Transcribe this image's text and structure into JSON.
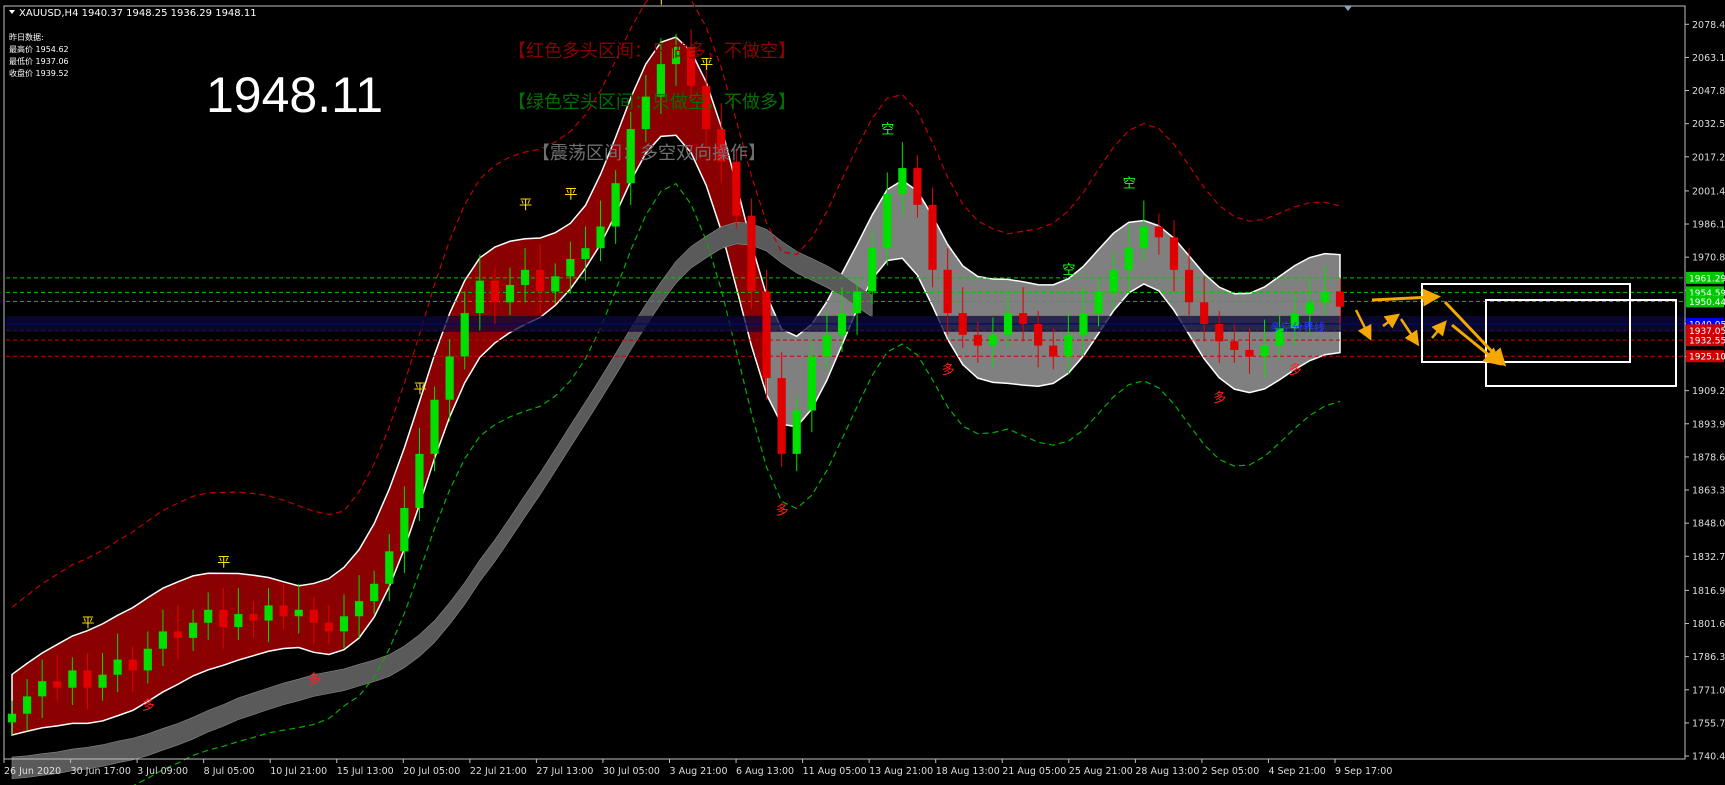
{
  "window": {
    "title": "XAUUSD,H4  1940.37 1948.25 1936.29 1948.11"
  },
  "info_box": {
    "heading": "昨日数据:",
    "lines": [
      "最高价 1954.62",
      "最低价 1937.06",
      "收盘价 1939.52"
    ]
  },
  "big_price": "1948.11",
  "legend_notes": [
    {
      "text": "【红色多头区间：只做多，不做空】",
      "color": "#8b0000"
    },
    {
      "text": "【绿色空头区间：只做空，不做多】",
      "color": "#007000"
    },
    {
      "text": "【震荡区间：多空双向操作】",
      "color": "#707070"
    }
  ],
  "divider_label": "多空分界线",
  "price_tags": [
    {
      "value": "1961.29",
      "color": "#00c800"
    },
    {
      "value": "1954.59",
      "color": "#00c800"
    },
    {
      "value": "1950.44",
      "color": "#00c800"
    },
    {
      "value": "1940.05",
      "color": "#0000ff"
    },
    {
      "value": "1937.05",
      "color": "#d00000"
    },
    {
      "value": "1932.55",
      "color": "#d00000"
    },
    {
      "value": "1925.10",
      "color": "#d00000"
    }
  ],
  "chart_data": {
    "type": "candlestick",
    "symbol": "XAUUSD",
    "timeframe": "H4",
    "ylim": [
      1740,
      2085
    ],
    "y_ticks": [
      "2078.40",
      "2063.10",
      "2047.80",
      "2032.50",
      "2017.20",
      "2001.45",
      "1986.15",
      "1970.85",
      "1955.55",
      "1940.25",
      "1924.95",
      "1909.20",
      "1893.90",
      "1878.60",
      "1863.30",
      "1848.00",
      "1832.70",
      "1816.95",
      "1801.65",
      "1786.35",
      "1771.05",
      "1755.75",
      "1740.45"
    ],
    "x_labels": [
      "26 Jun 2020",
      "30 Jun 17:00",
      "3 Jul 09:00",
      "8 Jul 05:00",
      "10 Jul 21:00",
      "15 Jul 13:00",
      "20 Jul 05:00",
      "22 Jul 21:00",
      "27 Jul 13:00",
      "30 Jul 05:00",
      "3 Aug 21:00",
      "6 Aug 13:00",
      "11 Aug 05:00",
      "13 Aug 21:00",
      "18 Aug 13:00",
      "21 Aug 05:00",
      "25 Aug 21:00",
      "28 Aug 13:00",
      "2 Sep 05:00",
      "4 Sep 21:00",
      "9 Sep 17:00"
    ],
    "closes": [
      1760,
      1768,
      1775,
      1772,
      1780,
      1772,
      1778,
      1785,
      1780,
      1790,
      1798,
      1795,
      1802,
      1808,
      1800,
      1806,
      1803,
      1810,
      1805,
      1808,
      1802,
      1798,
      1805,
      1812,
      1820,
      1835,
      1855,
      1880,
      1905,
      1925,
      1945,
      1960,
      1950,
      1958,
      1965,
      1955,
      1962,
      1970,
      1975,
      1985,
      2005,
      2030,
      2045,
      2060,
      2068,
      2050,
      2030,
      2015,
      1990,
      1955,
      1915,
      1880,
      1900,
      1925,
      1935,
      1945,
      1955,
      1975,
      2000,
      2012,
      1995,
      1965,
      1945,
      1935,
      1930,
      1935,
      1945,
      1940,
      1930,
      1925,
      1935,
      1945,
      1955,
      1965,
      1975,
      1985,
      1980,
      1965,
      1950,
      1940,
      1932,
      1928,
      1925,
      1930,
      1938,
      1945,
      1950,
      1955,
      1948
    ],
    "signals": [
      {
        "idx": 5,
        "type": "平",
        "pos": "above"
      },
      {
        "idx": 9,
        "type": "多",
        "pos": "below"
      },
      {
        "idx": 14,
        "type": "平",
        "pos": "above"
      },
      {
        "idx": 20,
        "type": "多",
        "pos": "below"
      },
      {
        "idx": 27,
        "type": "平",
        "pos": "above"
      },
      {
        "idx": 34,
        "type": "平",
        "pos": "above"
      },
      {
        "idx": 37,
        "type": "平",
        "pos": "above"
      },
      {
        "idx": 43,
        "type": "平",
        "pos": "above"
      },
      {
        "idx": 46,
        "type": "平",
        "pos": "above"
      },
      {
        "idx": 51,
        "type": "多",
        "pos": "below"
      },
      {
        "idx": 58,
        "type": "空",
        "pos": "above"
      },
      {
        "idx": 62,
        "type": "多",
        "pos": "below"
      },
      {
        "idx": 70,
        "type": "空",
        "pos": "above"
      },
      {
        "idx": 74,
        "type": "空",
        "pos": "above"
      },
      {
        "idx": 80,
        "type": "多",
        "pos": "below"
      },
      {
        "idx": 85,
        "type": "多",
        "pos": "below"
      }
    ]
  },
  "colors": {
    "bull_band": "#8b0000",
    "range_band": "#808080",
    "bull_candle": "#00e000",
    "bear_candle": "#e00000",
    "divider": "#0000ff",
    "arrows": "#f5a800",
    "grid_axis": "#c0c0c0"
  }
}
